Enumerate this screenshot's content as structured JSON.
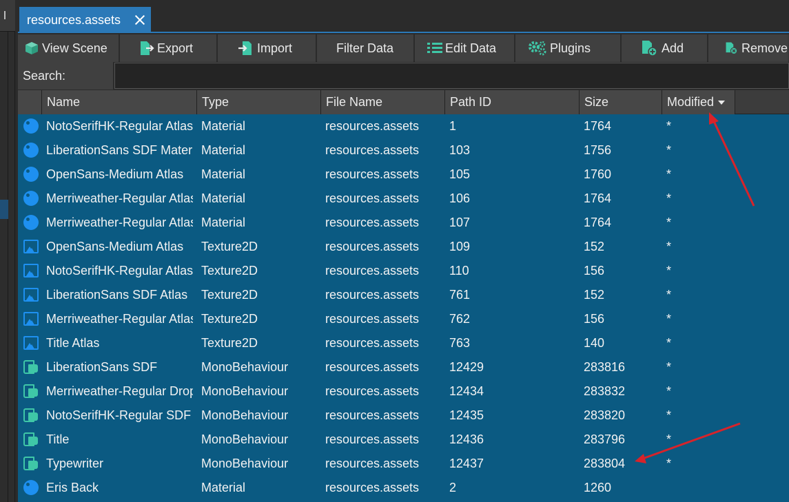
{
  "tab": {
    "title": "resources.assets"
  },
  "toolbar": {
    "view_scene": "View Scene",
    "export": "Export",
    "import": "Import",
    "filter_data": "Filter Data",
    "edit_data": "Edit Data",
    "plugins": "Plugins",
    "add": "Add",
    "remove": "Remove"
  },
  "search": {
    "label": "Search:",
    "value": ""
  },
  "columns": {
    "name": "Name",
    "type": "Type",
    "file_name": "File Name",
    "path_id": "Path ID",
    "size": "Size",
    "modified": "Modified"
  },
  "rows": [
    {
      "icon": "material-icon",
      "name": "NotoSerifHK-Regular Atlas",
      "type": "Material",
      "file": "resources.assets",
      "path_id": "1",
      "size": "1764",
      "modified": "*"
    },
    {
      "icon": "material-icon",
      "name": "LiberationSans SDF Material",
      "type": "Material",
      "file": "resources.assets",
      "path_id": "103",
      "size": "1756",
      "modified": "*"
    },
    {
      "icon": "material-icon",
      "name": "OpenSans-Medium Atlas",
      "type": "Material",
      "file": "resources.assets",
      "path_id": "105",
      "size": "1760",
      "modified": "*"
    },
    {
      "icon": "material-icon",
      "name": "Merriweather-Regular Atlas",
      "type": "Material",
      "file": "resources.assets",
      "path_id": "106",
      "size": "1764",
      "modified": "*"
    },
    {
      "icon": "material-icon",
      "name": "Merriweather-Regular Atlas",
      "type": "Material",
      "file": "resources.assets",
      "path_id": "107",
      "size": "1764",
      "modified": "*"
    },
    {
      "icon": "texture-icon",
      "name": "OpenSans-Medium Atlas",
      "type": "Texture2D",
      "file": "resources.assets",
      "path_id": "109",
      "size": "152",
      "modified": "*"
    },
    {
      "icon": "texture-icon",
      "name": "NotoSerifHK-Regular Atlas",
      "type": "Texture2D",
      "file": "resources.assets",
      "path_id": "110",
      "size": "156",
      "modified": "*"
    },
    {
      "icon": "texture-icon",
      "name": "LiberationSans SDF Atlas",
      "type": "Texture2D",
      "file": "resources.assets",
      "path_id": "761",
      "size": "152",
      "modified": "*"
    },
    {
      "icon": "texture-icon",
      "name": "Merriweather-Regular Atlas",
      "type": "Texture2D",
      "file": "resources.assets",
      "path_id": "762",
      "size": "156",
      "modified": "*"
    },
    {
      "icon": "texture-icon",
      "name": "Title Atlas",
      "type": "Texture2D",
      "file": "resources.assets",
      "path_id": "763",
      "size": "140",
      "modified": "*"
    },
    {
      "icon": "script-icon",
      "name": "LiberationSans SDF",
      "type": "MonoBehaviour",
      "file": "resources.assets",
      "path_id": "12429",
      "size": "283816",
      "modified": "*"
    },
    {
      "icon": "script-icon",
      "name": "Merriweather-Regular Drop",
      "type": "MonoBehaviour",
      "file": "resources.assets",
      "path_id": "12434",
      "size": "283832",
      "modified": "*"
    },
    {
      "icon": "script-icon",
      "name": "NotoSerifHK-Regular SDF",
      "type": "MonoBehaviour",
      "file": "resources.assets",
      "path_id": "12435",
      "size": "283820",
      "modified": "*"
    },
    {
      "icon": "script-icon",
      "name": "Title",
      "type": "MonoBehaviour",
      "file": "resources.assets",
      "path_id": "12436",
      "size": "283796",
      "modified": "*"
    },
    {
      "icon": "script-icon",
      "name": "Typewriter",
      "type": "MonoBehaviour",
      "file": "resources.assets",
      "path_id": "12437",
      "size": "283804",
      "modified": "*"
    },
    {
      "icon": "material-icon",
      "name": "Eris Back",
      "type": "Material",
      "file": "resources.assets",
      "path_id": "2",
      "size": "1260",
      "modified": ""
    }
  ],
  "colors": {
    "tab_accent": "#2b79b8",
    "row_selected": "#0b5a82",
    "material_icon": "#1e90f0",
    "script_icon": "#3fc7a7",
    "annotation_arrow": "#d8232a"
  }
}
